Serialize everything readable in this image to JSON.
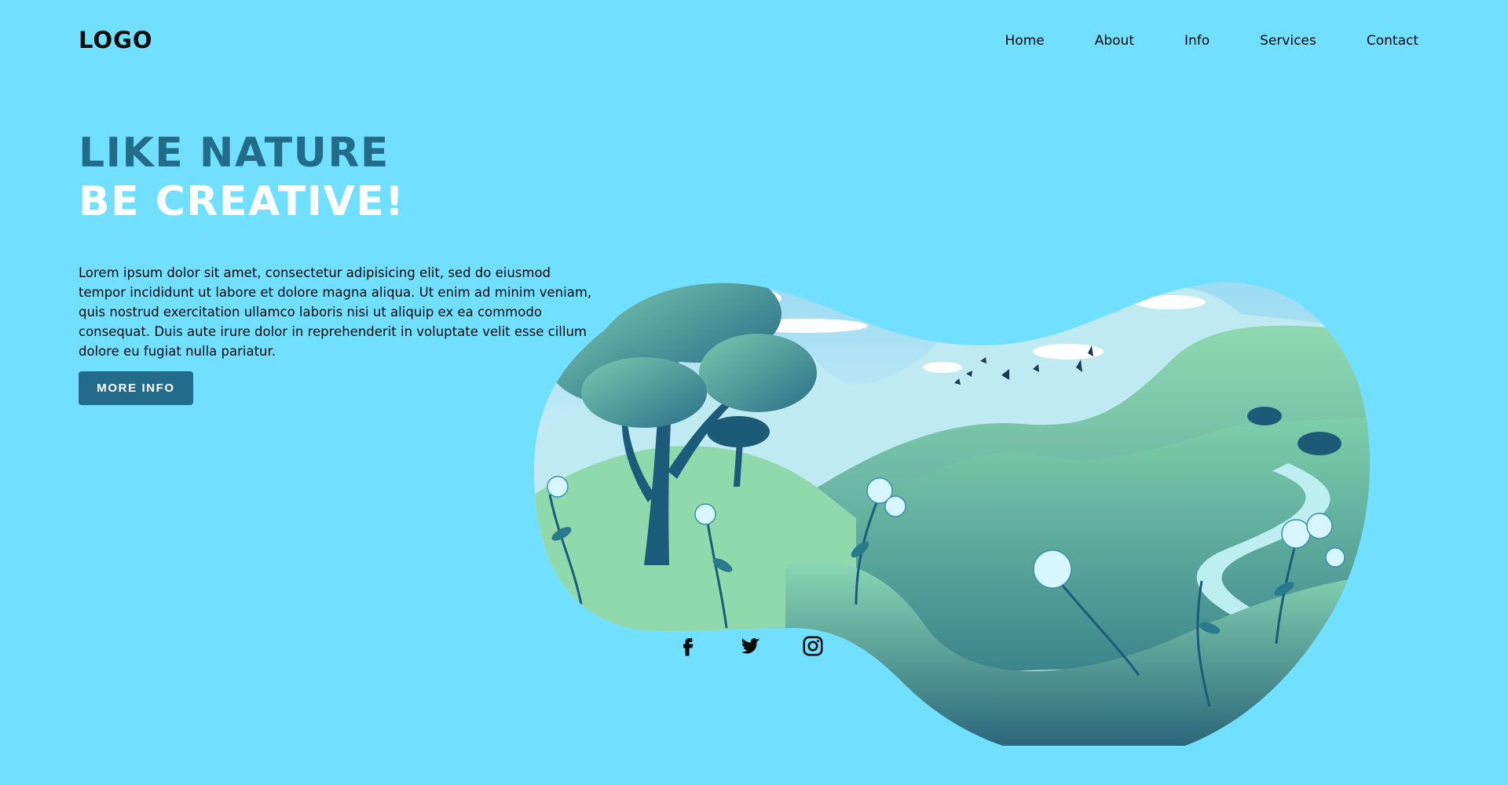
{
  "header": {
    "logo": "LOGO",
    "nav": [
      "Home",
      "About",
      "Info",
      "Services",
      "Contact"
    ]
  },
  "hero": {
    "title_line1": "LIKE NATURE",
    "title_line2": "BE CREATIVE!",
    "body": "Lorem ipsum dolor sit amet, consectetur adipisicing elit, sed do eiusmod tempor incididunt ut labore et dolore magna aliqua. Ut enim ad minim veniam, quis nostrud exercitation ullamco laboris nisi ut aliquip ex ea commodo consequat. Duis aute irure dolor in reprehenderit in voluptate velit esse cillum dolore eu fugiat nulla pariatur.",
    "button_label": "MORE INFO"
  },
  "social": {
    "icons": [
      "facebook-icon",
      "twitter-icon",
      "instagram-icon"
    ]
  },
  "colors": {
    "background": "#71dfff",
    "accent": "#226b8a",
    "title_dark": "#226c8a",
    "title_light": "#ffffff"
  }
}
